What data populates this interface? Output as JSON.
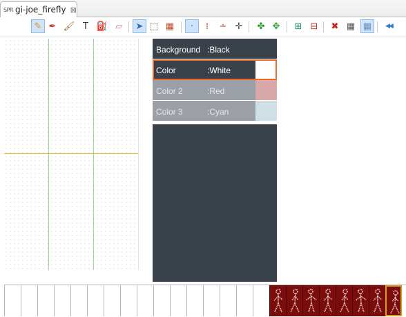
{
  "tab": {
    "icon_text": "SPR",
    "title": "gi-joe_firefly",
    "close_glyph": "⊠"
  },
  "toolbar": {
    "tools": [
      {
        "name": "pencil-tool-icon",
        "glyph": "✎",
        "color": "#d49a1c",
        "selected": true
      },
      {
        "name": "eyedropper-tool-icon",
        "glyph": "✒",
        "color": "#d0342c"
      },
      {
        "name": "brush-tool-icon",
        "glyph": "🖌",
        "color": "#a0682c"
      },
      {
        "name": "text-tool-icon",
        "glyph": "T",
        "color": "#333333"
      },
      {
        "name": "fill-tool-icon",
        "glyph": "⛽",
        "color": "#3a7bbf"
      },
      {
        "name": "eraser-tool-icon",
        "glyph": "▱",
        "color": "#d07a8a"
      },
      {
        "name": "select-arrow-tool-icon",
        "glyph": "➤",
        "color": "#2a6fb8",
        "selected": true
      },
      {
        "name": "rect-select-tool-icon",
        "glyph": "⬚",
        "color": "#333333"
      },
      {
        "name": "color-grid-tool-icon",
        "glyph": "▦",
        "color": "#c44c2c"
      },
      {
        "name": "point-tool-icon",
        "glyph": "·",
        "color": "#2a6fb8",
        "selected": true
      },
      {
        "name": "vertical-guide-tool-icon",
        "glyph": "⁞",
        "color": "#c23a2a"
      },
      {
        "name": "horizontal-guide-tool-icon",
        "glyph": "∸",
        "color": "#c23a2a"
      },
      {
        "name": "cross-guide-tool-icon",
        "glyph": "✛",
        "color": "#444444"
      },
      {
        "name": "puzzle-tool-icon",
        "glyph": "✤",
        "color": "#2f9a2f"
      },
      {
        "name": "puzzle-piece-tool-icon",
        "glyph": "✥",
        "color": "#2f9a2f"
      },
      {
        "name": "add-frame-tool-icon",
        "glyph": "⊞",
        "color": "#2f8f5a"
      },
      {
        "name": "remove-frame-tool-icon",
        "glyph": "⊟",
        "color": "#c23a2a"
      },
      {
        "name": "delete-tool-icon",
        "glyph": "✖",
        "color": "#d02020"
      },
      {
        "name": "grid-tool-icon",
        "glyph": "▦",
        "color": "#555555"
      },
      {
        "name": "fine-grid-tool-icon",
        "glyph": "▦",
        "color": "#6a8fc0",
        "selected": true
      },
      {
        "name": "rewind-tool-icon",
        "glyph": "◀◀",
        "color": "#2a7fd0"
      }
    ]
  },
  "palette": {
    "entries": [
      {
        "name": "Background",
        "value": ":Black",
        "swatch": "#39424a",
        "dim": false
      },
      {
        "name": "Color",
        "value": ":White",
        "swatch": "#ffffff",
        "dim": false,
        "selected": true
      },
      {
        "name": "Color 2",
        "value": ":Red",
        "swatch": "#d9a8a8",
        "dim": true
      },
      {
        "name": "Color 3",
        "value": ":Cyan",
        "swatch": "#cfe0e6",
        "dim": true
      }
    ]
  },
  "colors": {
    "palette_bg": "#39424a",
    "selection_border": "#e86a2c",
    "filled_frame": "#7a0c0c",
    "current_frame_border": "#d8a020",
    "guide_vertical": "#8fe08f",
    "guide_horizontal": "#e0c020"
  },
  "frames": {
    "total": 24,
    "filled_start": 16,
    "current_index": 23
  }
}
